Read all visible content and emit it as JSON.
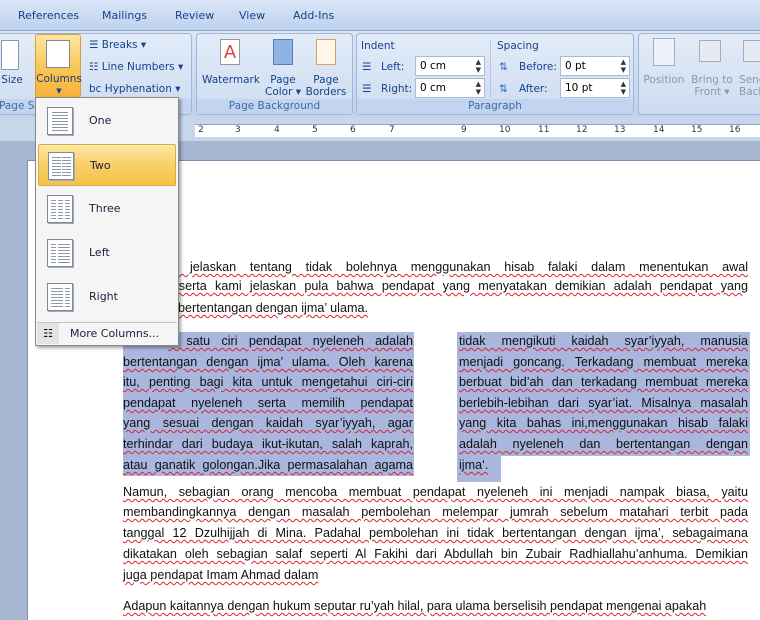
{
  "tabs": [
    "References",
    "Mailings",
    "Review",
    "View",
    "Add-Ins"
  ],
  "page_setup": {
    "size": "Size",
    "columns": "Columns",
    "breaks": "Breaks",
    "line_numbers": "Line Numbers",
    "hyphenation": "Hyphenation",
    "group_label": "Page Se"
  },
  "page_background": {
    "watermark": "Watermark",
    "page_color_1": "Page",
    "page_color_2": "Color",
    "page_borders_1": "Page",
    "page_borders_2": "Borders",
    "group_label": "Page Background"
  },
  "paragraph": {
    "indent": "Indent",
    "left_label": "Left:",
    "left_value": "0 cm",
    "right_label": "Right:",
    "right_value": "0 cm",
    "spacing": "Spacing",
    "before_label": "Before:",
    "before_value": "0 pt",
    "after_label": "After:",
    "after_value": "10 pt",
    "group_label": "Paragraph"
  },
  "arrange": {
    "position": "Position",
    "bring_1": "Bring to",
    "bring_2": "Front",
    "send_1": "Send",
    "send_2": "Back"
  },
  "ruler": [
    "2",
    "3",
    "4",
    "5",
    "6",
    "7",
    "9",
    "10",
    "11",
    "12",
    "13",
    "14",
    "15",
    "16"
  ],
  "columns_menu": {
    "options": [
      "One",
      "Two",
      "Three",
      "Left",
      "Right"
    ],
    "selected": "Two",
    "more": "More Columns..."
  },
  "document": {
    "para1": [
      "mi jelaskan tentang tidak bolehnya menggunakan hisab falaki dalam menentukan awal",
      "n, serta kami jelaskan pula bahwa pendapat yang menyatakan demikian adalah pendapat yang",
      "h, bertentangan dengan ijma’ ulama."
    ],
    "col_left": [
      "n satu ciri pendapat nyeleneh adalah",
      "bertentangan dengan ijma’ ulama. Oleh karena",
      "itu, penting bagi kita untuk mengetahui ciri-ciri",
      "pendapat nyeleneh serta memilih pendapat",
      "yang sesuai dengan kaidah syar’iyyah, agar",
      "terhindar dari budaya ikut-ikutan, salah kaprah,",
      "atau ganatik golongan.Jika permasalahan agama"
    ],
    "col_right": [
      "tidak mengikuti kaidah syar’iyyah, manusia",
      "menjadi goncang. Terkadang membuat mereka",
      "berbuat bid’ah dan terkadang membuat mereka",
      "berlebih-lebihan dari syar’iat. Misalnya masalah",
      "yang kita bahas ini,menggunakan hisab falaki",
      "adalah nyeleneh dan bertentangan dengan",
      "ijma‘."
    ],
    "para3": [
      "Namun, sebagian orang mencoba membuat pendapat nyeleneh ini menjadi nampak biasa, yaitu",
      "membandingkannya dengan masalah pembolehan melempar jumrah sebelum matahari terbit pada",
      "tanggal 12 Dzulhijjah di Mina. Padahal pembolehan ini tidak bertentangan dengan ijma’, sebagaimana",
      "dikatakan oleh sebagian salaf seperti Al Fakihi dari Abdullah bin Zubair Radhiallahu’anhuma. Demikian",
      "juga pendapat Imam Ahmad dalam"
    ],
    "para4": [
      "Adapun kaitannya dengan hukum seputar ru’yah hilal, para ulama berselisih pendapat mengenai apakah"
    ]
  },
  "colors": {
    "selection": "#a9b7de",
    "menu_highlight": "#f8cf67",
    "ribbon_text": "#15428b"
  }
}
